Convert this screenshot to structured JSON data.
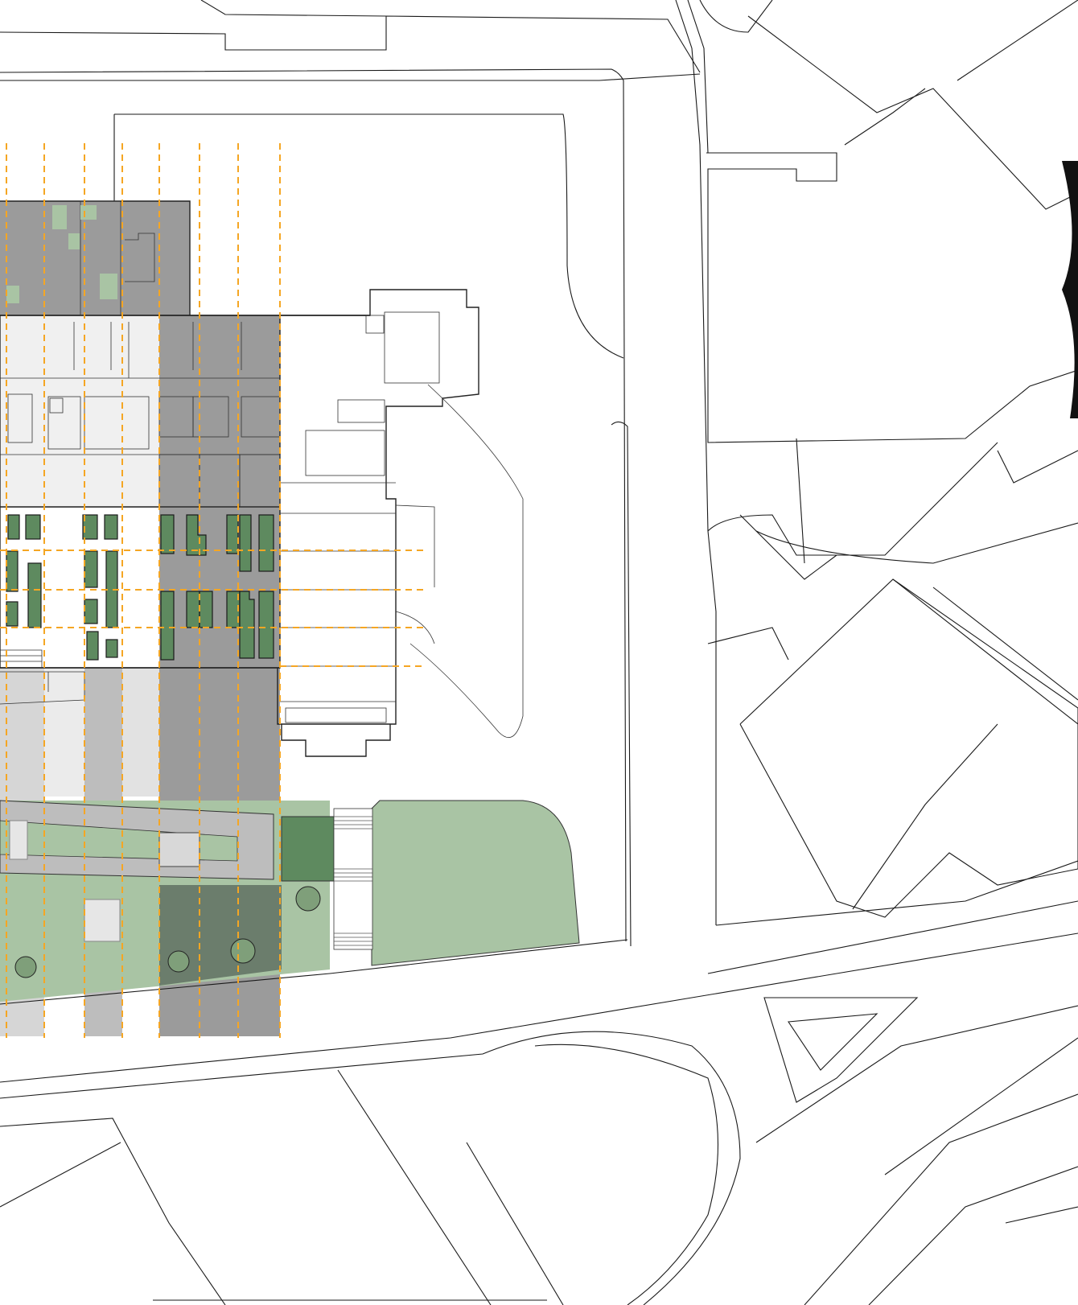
{
  "colors": {
    "background": "#ffffff",
    "linework": "#1a1a1a",
    "grid_lines": "#f5a623",
    "zone_dark_grey": "#9b9b9b",
    "zone_mid_grey": "#bdbdbd",
    "zone_light_grey": "#d6d6d6",
    "green_dark": "#5e8a5f",
    "green_bed": "#6f9a66",
    "green_light": "#a9c4a4",
    "green_canopy": "#7f9f7a"
  },
  "icons": {
    "tree": "circle-outline",
    "stair": "parallel-lines"
  }
}
